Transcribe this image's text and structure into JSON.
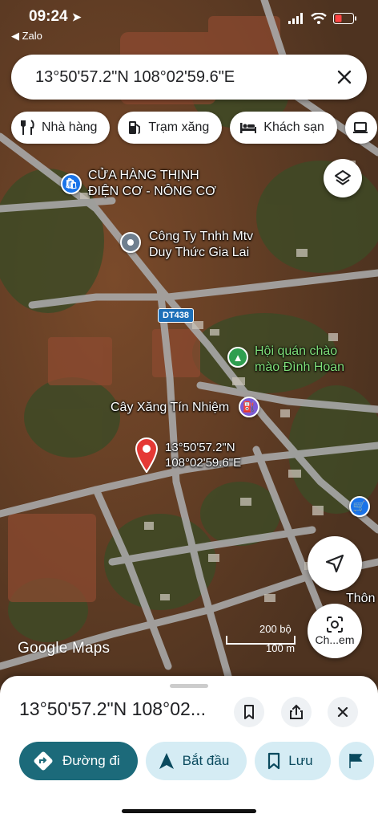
{
  "status": {
    "time": "09:24",
    "back_app": "◀ Zalo"
  },
  "search": {
    "query": "13°50'57.2\"N 108°02'59.6\"E"
  },
  "chips": [
    {
      "icon": "fork-knife-icon",
      "label": "Nhà hàng"
    },
    {
      "icon": "gas-pump-icon",
      "label": "Trạm xăng"
    },
    {
      "icon": "bed-icon",
      "label": "Khách sạn"
    }
  ],
  "map": {
    "labels": {
      "poi1_line1": "CỬA HÀNG THỊNH",
      "poi1_line2": "ĐIỆN CƠ - NÔNG CƠ",
      "poi2_line1": "Công Ty Tnhh Mtv",
      "poi2_line2": "Duy Thức Gia Lai",
      "poi3_line1": "Hội quán chào",
      "poi3_line2": "mào Đình Hoan",
      "poi4": "Cây Xăng Tín Nhiệm",
      "pin_line1": "13°50'57.2\"N",
      "pin_line2": "108°02'59.6\"E",
      "road_badge": "DT438",
      "edge_label": "Thôn",
      "camera_label": "Ch...em"
    },
    "scale": {
      "top": "200 bộ",
      "bottom": "100 m"
    },
    "attribution": "Google Maps",
    "colors": {
      "pin": "#e53935",
      "road": "#9a9a9a",
      "poi_blue": "#1a73e8",
      "poi_green": "#2e9e4f",
      "poi_gray": "#6f7f8f",
      "fuel_purple": "#7b5cd6"
    }
  },
  "sheet": {
    "title": "13°50'57.2\"N 108°02...",
    "actions": [
      {
        "icon": "directions-icon",
        "label": "Đường đi"
      },
      {
        "icon": "navigation-arrow-icon",
        "label": "Bắt đầu"
      },
      {
        "icon": "bookmark-icon",
        "label": "Lưu"
      }
    ]
  }
}
